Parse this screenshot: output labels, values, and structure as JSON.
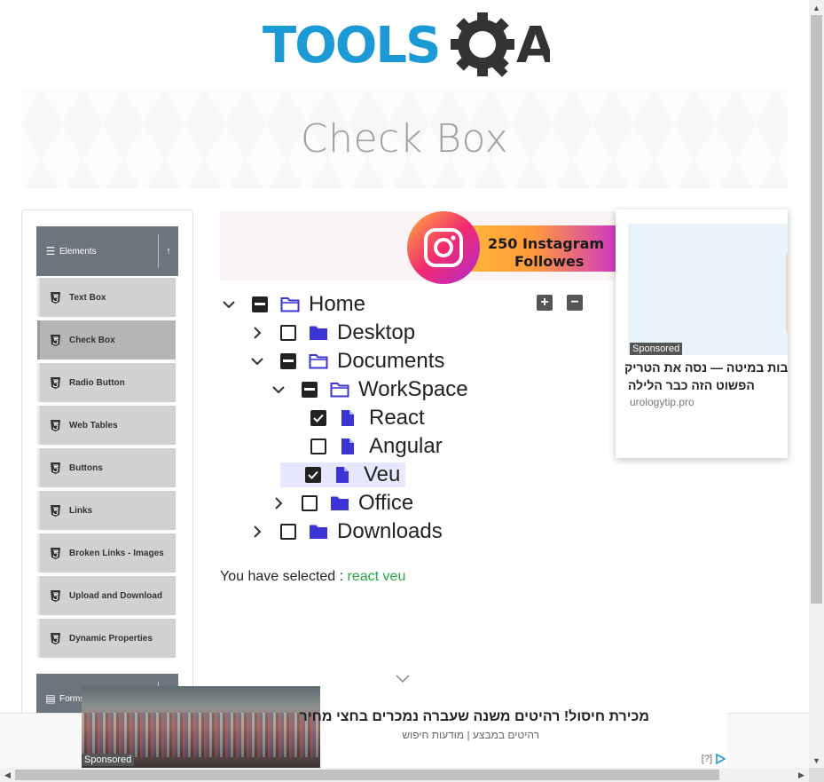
{
  "header": {
    "logo_text_blue": "TOOLS",
    "logo_text_dark": "A",
    "page_title": "Check Box"
  },
  "sidebar": {
    "groups": [
      {
        "label": "Elements",
        "icon": "list-icon",
        "toggle_icon": "arrow-up-icon"
      },
      {
        "label": "Forms",
        "icon": "form-icon"
      }
    ],
    "items": [
      {
        "label": "Text Box"
      },
      {
        "label": "Check Box",
        "active": true
      },
      {
        "label": "Radio Button"
      },
      {
        "label": "Web Tables"
      },
      {
        "label": "Buttons"
      },
      {
        "label": "Links"
      },
      {
        "label": "Broken Links - Images"
      },
      {
        "label": "Upload and Download"
      },
      {
        "label": "Dynamic Properties"
      }
    ]
  },
  "ad_top": {
    "banner_line1": "250 Instagram",
    "banner_line2": "Followes"
  },
  "ad_right": {
    "badge": "Sponsored",
    "title_line1": ":זבות במיטה — נסה את הטריק",
    "title_line2": "הפשוט הזה כבר הלילה",
    "source": "urologytip.pro"
  },
  "tree": {
    "expand_all_label": "+",
    "collapse_all_label": "−",
    "nodes": [
      {
        "label": "Home",
        "state": "half",
        "expanded": true,
        "type": "folder-open"
      },
      {
        "label": "Desktop",
        "state": "unchecked",
        "expanded": false,
        "type": "folder"
      },
      {
        "label": "Documents",
        "state": "half",
        "expanded": true,
        "type": "folder-open"
      },
      {
        "label": "WorkSpace",
        "state": "half",
        "expanded": true,
        "type": "folder-open"
      },
      {
        "label": "React",
        "state": "checked",
        "type": "file"
      },
      {
        "label": "Angular",
        "state": "unchecked",
        "type": "file"
      },
      {
        "label": "Veu",
        "state": "checked",
        "type": "file"
      },
      {
        "label": "Office",
        "state": "unchecked",
        "expanded": false,
        "type": "folder"
      },
      {
        "label": "Downloads",
        "state": "unchecked",
        "expanded": false,
        "type": "folder"
      }
    ]
  },
  "result": {
    "label": "You have selected :",
    "values": "react veu"
  },
  "ad_bottom": {
    "badge": "Sponsored",
    "title": "מכירת חיסול! רהיטים משנה שעברה נמכרים בחצי מחיר",
    "subtitle": "רהיטים במבצע | מודעות חיפוש",
    "info_label": "[?]"
  },
  "colors": {
    "brand_blue": "#1b9ad6",
    "brand_dark": "#333333",
    "folder_blue": "#3c35d6",
    "sidebar_header": "#6c757d",
    "result_green": "#28a745"
  }
}
